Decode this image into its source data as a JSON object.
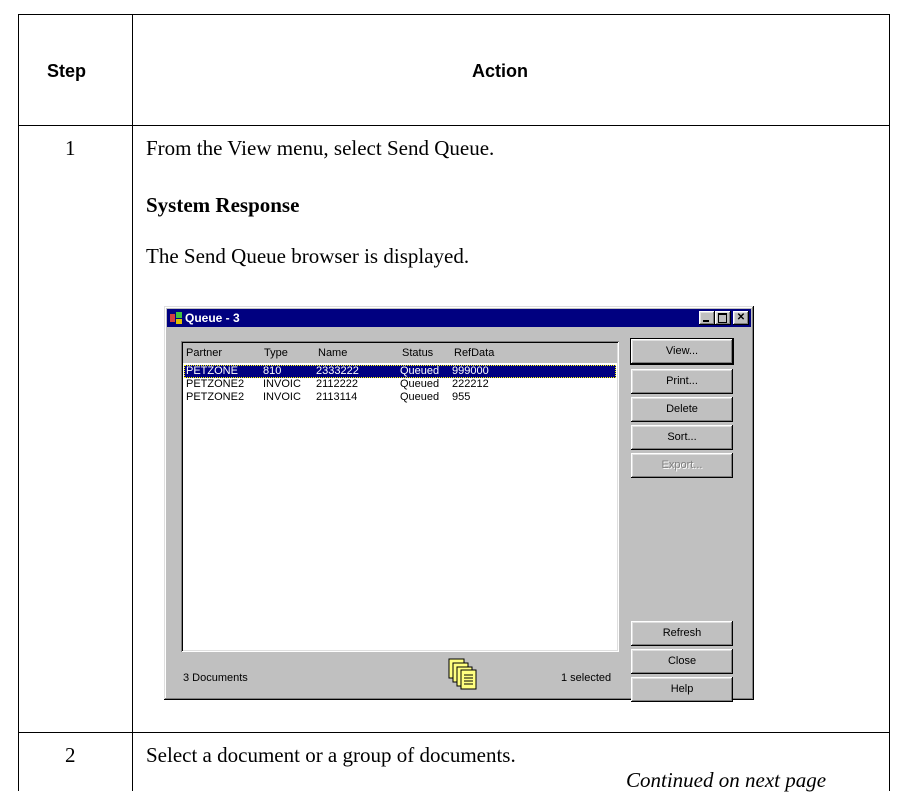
{
  "table": {
    "header_step": "Step",
    "header_action": "Action",
    "rows": [
      {
        "step": "1",
        "instruction": "From the View menu, select Send Queue.",
        "response_heading": "System Response",
        "response_text": "The Send Queue browser is displayed."
      },
      {
        "step": "2",
        "instruction": "Select a document or a group of documents."
      }
    ],
    "continued": "Continued on next page"
  },
  "window": {
    "title": "Queue - 3",
    "columns": [
      "Partner",
      "Type",
      "Name",
      "Status",
      "RefData"
    ],
    "rows": [
      {
        "partner": "PETZONE",
        "type": "810",
        "name": "2333222",
        "status": "Queued",
        "refdata": "999000",
        "selected": true
      },
      {
        "partner": "PETZONE2",
        "type": "INVOIC",
        "name": "2112222",
        "status": "Queued",
        "refdata": "222212",
        "selected": false
      },
      {
        "partner": "PETZONE2",
        "type": "INVOIC",
        "name": "2113114",
        "status": "Queued",
        "refdata": "955",
        "selected": false
      }
    ],
    "buttons": {
      "view": "View...",
      "print": "Print...",
      "delete": "Delete",
      "sort": "Sort...",
      "export": "Export...",
      "refresh": "Refresh",
      "close": "Close",
      "help": "Help"
    },
    "status_left": "3 Documents",
    "status_right": "1 selected"
  }
}
